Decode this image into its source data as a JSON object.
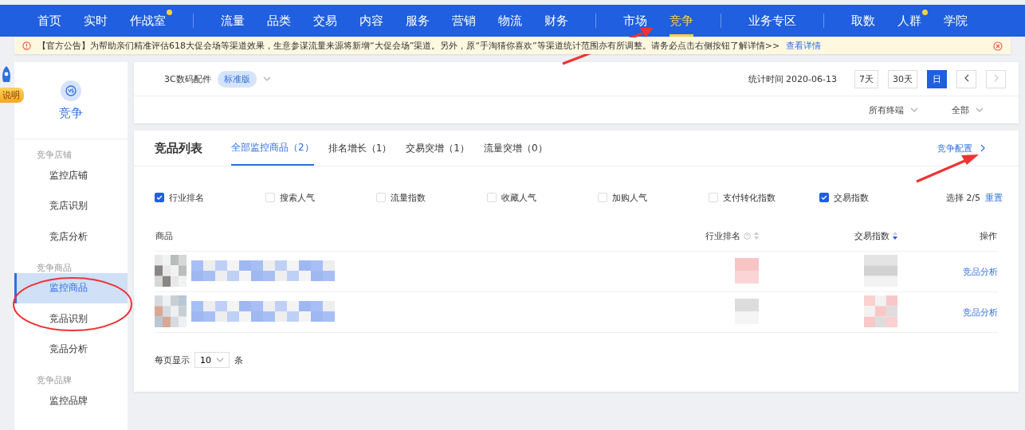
{
  "nav": {
    "groups": [
      [
        {
          "label": "首页",
          "selected": false,
          "dot": false
        },
        {
          "label": "实时",
          "selected": false,
          "dot": false
        },
        {
          "label": "作战室",
          "selected": false,
          "dot": true
        }
      ],
      [
        {
          "label": "流量",
          "selected": false,
          "dot": false
        },
        {
          "label": "品类",
          "selected": false,
          "dot": false
        },
        {
          "label": "交易",
          "selected": false,
          "dot": false
        },
        {
          "label": "内容",
          "selected": false,
          "dot": false
        },
        {
          "label": "服务",
          "selected": false,
          "dot": false
        },
        {
          "label": "营销",
          "selected": false,
          "dot": false
        },
        {
          "label": "物流",
          "selected": false,
          "dot": false
        },
        {
          "label": "财务",
          "selected": false,
          "dot": false
        }
      ],
      [
        {
          "label": "市场",
          "selected": false,
          "dot": false
        },
        {
          "label": "竞争",
          "selected": true,
          "dot": false
        }
      ],
      [
        {
          "label": "业务专区",
          "selected": false,
          "dot": false
        }
      ],
      [
        {
          "label": "取数",
          "selected": false,
          "dot": false
        },
        {
          "label": "人群",
          "selected": false,
          "dot": true
        },
        {
          "label": "学院",
          "selected": false,
          "dot": false
        }
      ]
    ]
  },
  "notice": {
    "text": "【官方公告】为帮助亲们精准评估618大促会场等渠道效果，生意参谋流量来源将新增“大促会场”渠道。另外，原“手淘猜你喜欢”等渠道统计范围亦有所调整。请务必点击右侧按钮了解详情>>",
    "link": "查看详情"
  },
  "help_badge": "说明",
  "sidebar": {
    "title": "竞争",
    "sections": [
      {
        "heading": "竞争店铺",
        "items": [
          {
            "label": "监控店铺",
            "selected": false
          },
          {
            "label": "竞店识别",
            "selected": false
          },
          {
            "label": "竞店分析",
            "selected": false
          }
        ]
      },
      {
        "heading": "竞争商品",
        "items": [
          {
            "label": "监控商品",
            "selected": true
          },
          {
            "label": "竞品识别",
            "selected": false
          },
          {
            "label": "竞品分析",
            "selected": false
          }
        ]
      },
      {
        "heading": "竞争品牌",
        "items": [
          {
            "label": "监控品牌",
            "selected": false
          }
        ]
      }
    ]
  },
  "filter_bar": {
    "category": "3C数码配件",
    "edition": "标准版",
    "stat_time": "统计时间 2020-06-13",
    "periods": [
      {
        "label": "7天",
        "selected": false
      },
      {
        "label": "30天",
        "selected": false
      },
      {
        "label": "日",
        "selected": true
      }
    ],
    "next_disabled": true,
    "terminal": "所有终端",
    "scope": "全部"
  },
  "list": {
    "title": "竞品列表",
    "tabs": [
      {
        "label": "全部监控商品（2）",
        "selected": true
      },
      {
        "label": "排名增长（1）",
        "selected": false
      },
      {
        "label": "交易突增（1）",
        "selected": false
      },
      {
        "label": "流量突增（0）",
        "selected": false
      }
    ],
    "config_link": "竞争配置",
    "metrics": [
      {
        "label": "行业排名",
        "checked": true
      },
      {
        "label": "搜索人气",
        "checked": false
      },
      {
        "label": "流量指数",
        "checked": false
      },
      {
        "label": "收藏人气",
        "checked": false
      },
      {
        "label": "加购人气",
        "checked": false
      },
      {
        "label": "支付转化指数",
        "checked": false
      },
      {
        "label": "交易指数",
        "checked": true
      }
    ],
    "selection": "选择 2/5",
    "reset": "重置",
    "columns": [
      {
        "label": "商品",
        "help": false,
        "sortable": false
      },
      {
        "label": "行业排名",
        "help": true,
        "sortable": true,
        "sorted": false
      },
      {
        "label": "交易指数",
        "help": false,
        "sortable": true,
        "sorted": true
      },
      {
        "label": "操作",
        "help": false,
        "sortable": false
      }
    ],
    "rows": [
      {
        "action": "竞品分析"
      },
      {
        "action": "竞品分析"
      }
    ],
    "page_size_label": "每页显示",
    "page_size": "10",
    "page_size_unit": "条"
  }
}
